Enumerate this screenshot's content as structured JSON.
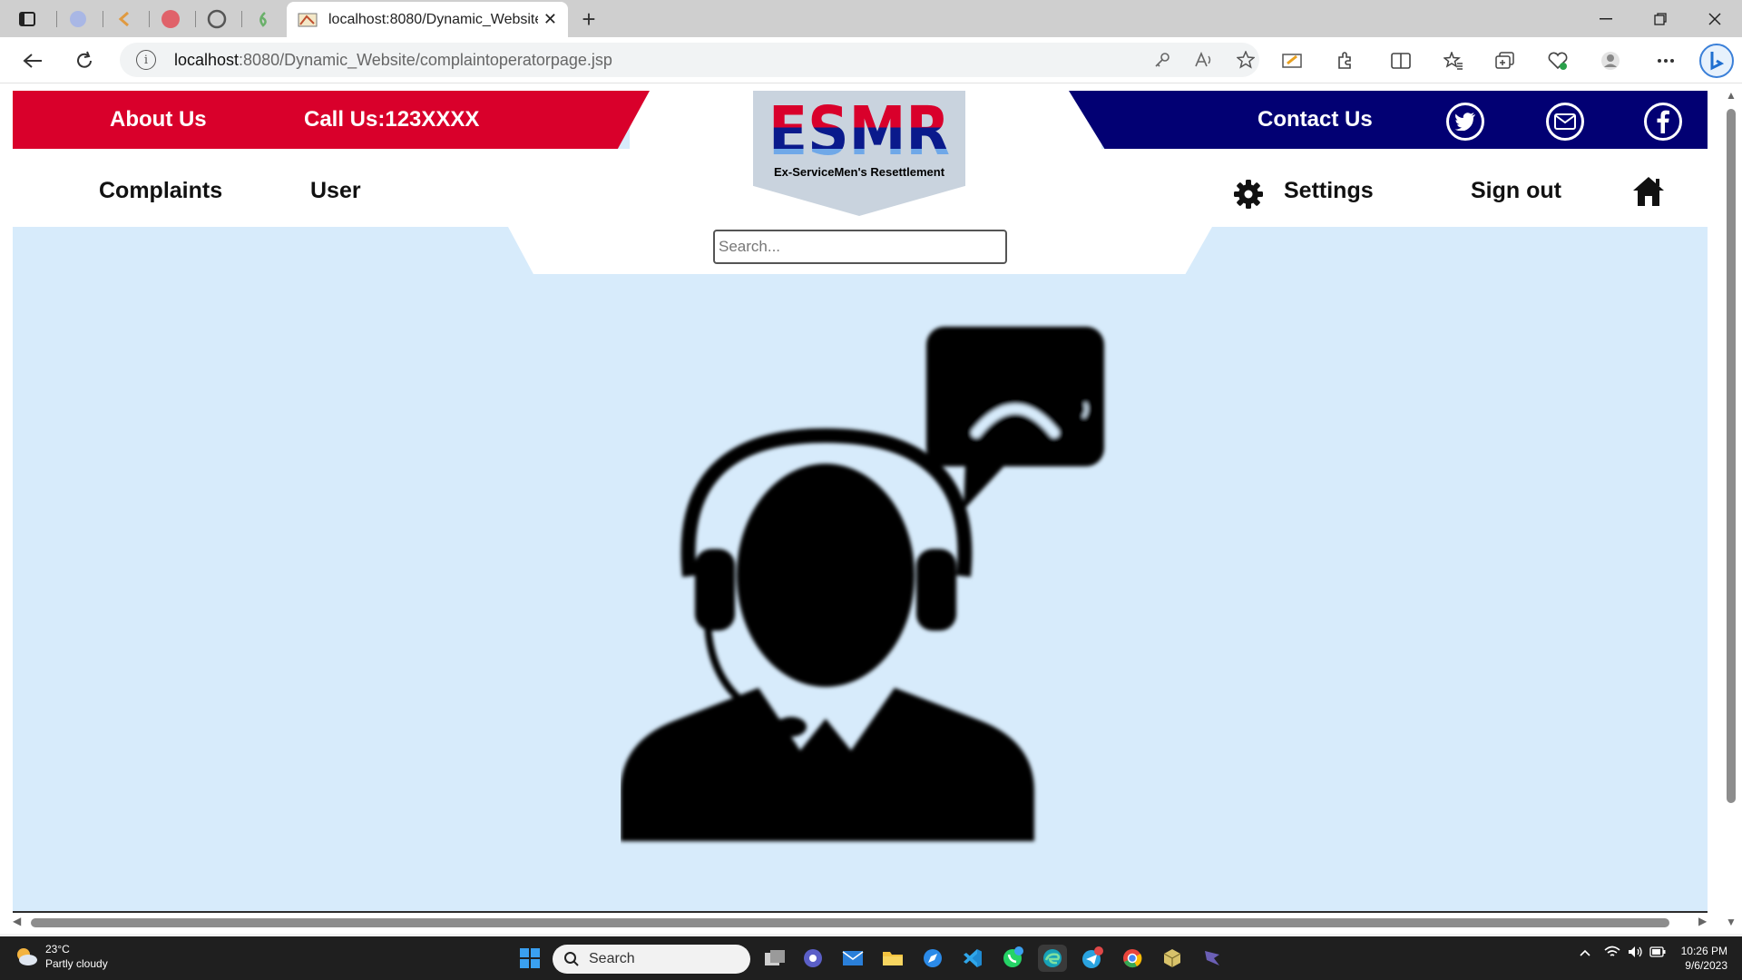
{
  "browser": {
    "tab": {
      "title": "localhost:8080/Dynamic_Website",
      "close": "✕"
    },
    "new_tab": "+",
    "url_host": "localhost",
    "url_rest": ":8080/Dynamic_Website/complaintoperatorpage.jsp"
  },
  "header": {
    "about": "About Us",
    "call": "Call Us:123XXXX",
    "contact": "Contact Us",
    "social": [
      "twitter-icon",
      "mail-icon",
      "facebook-icon"
    ]
  },
  "logo": {
    "title": "ESMR",
    "subtitle": "Ex-ServiceMen's Resettlement"
  },
  "nav": {
    "complaints": "Complaints",
    "user": "User",
    "settings": "Settings",
    "signout": "Sign out"
  },
  "search": {
    "placeholder": "Search..."
  },
  "colors": {
    "red": "#d9002b",
    "navy": "#020073",
    "page_bg": "#d7ebfb"
  },
  "taskbar": {
    "temperature": "23°C",
    "weather": "Partly cloudy",
    "search": "Search",
    "time": "10:26 PM",
    "date": "9/6/2023"
  }
}
